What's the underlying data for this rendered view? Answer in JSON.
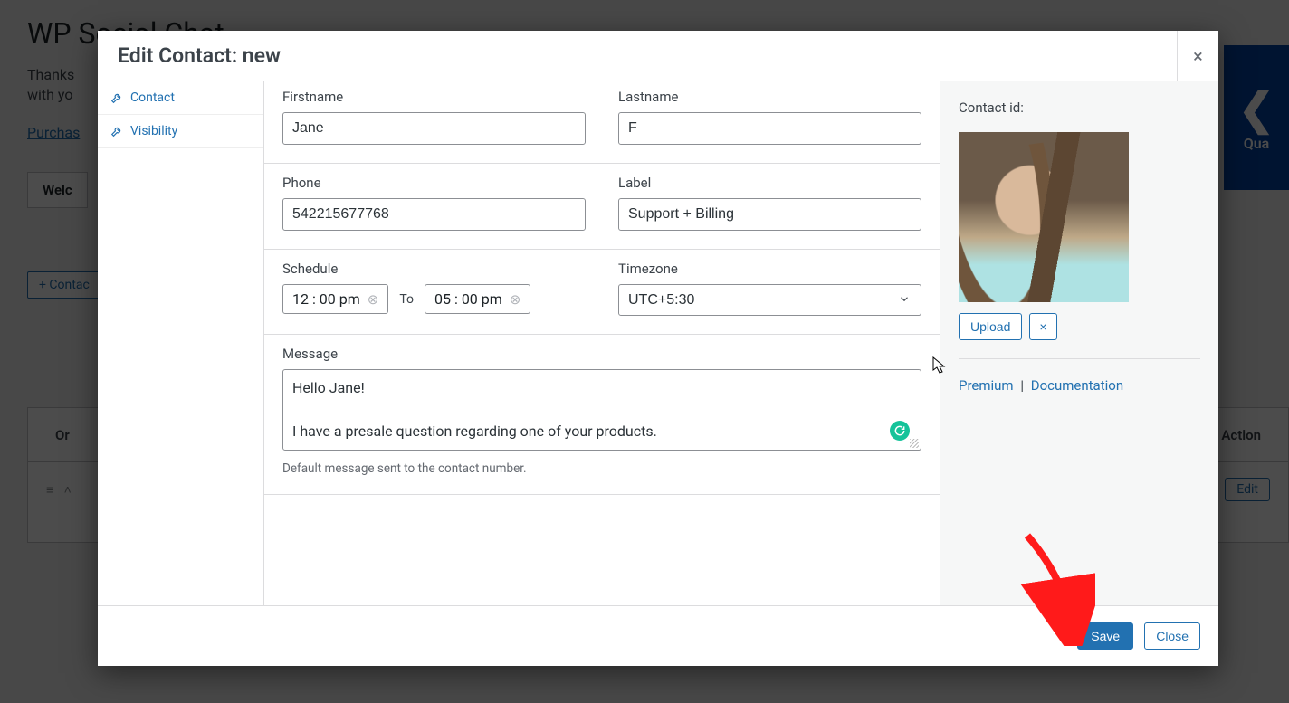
{
  "bg": {
    "title": "WP Social Chat",
    "thanks": "Thanks",
    "with_yo": "with yo",
    "purchase": "Purchas",
    "tab": "Welc",
    "add_contact": "+ Contac",
    "col_order": "Or",
    "col_action": "Action",
    "edit": "Edit",
    "badge": "Qua"
  },
  "modal": {
    "title": "Edit Contact: new",
    "close": "×",
    "side_tabs": {
      "contact": "Contact",
      "visibility": "Visibility"
    }
  },
  "form": {
    "firstname": {
      "label": "Firstname",
      "value": "Jane"
    },
    "lastname": {
      "label": "Lastname",
      "value": "F"
    },
    "phone": {
      "label": "Phone",
      "value": "542215677768"
    },
    "labelfield": {
      "label": "Label",
      "value": "Support + Billing"
    },
    "schedule": {
      "label": "Schedule",
      "from": "12 : 00   pm",
      "to_text": "To",
      "to": "05 : 00   pm"
    },
    "timezone": {
      "label": "Timezone",
      "value": "UTC+5:30"
    },
    "message": {
      "label": "Message",
      "line1": "Hello Jane!",
      "line2": "I have a presale question regarding one of your products."
    },
    "message_helper": "Default message sent to the contact number."
  },
  "right": {
    "contact_id_label": "Contact id:",
    "upload": "Upload",
    "clear": "×",
    "premium": "Premium",
    "sep": "|",
    "docs": "Documentation"
  },
  "footer": {
    "save": "Save",
    "close": "Close"
  }
}
